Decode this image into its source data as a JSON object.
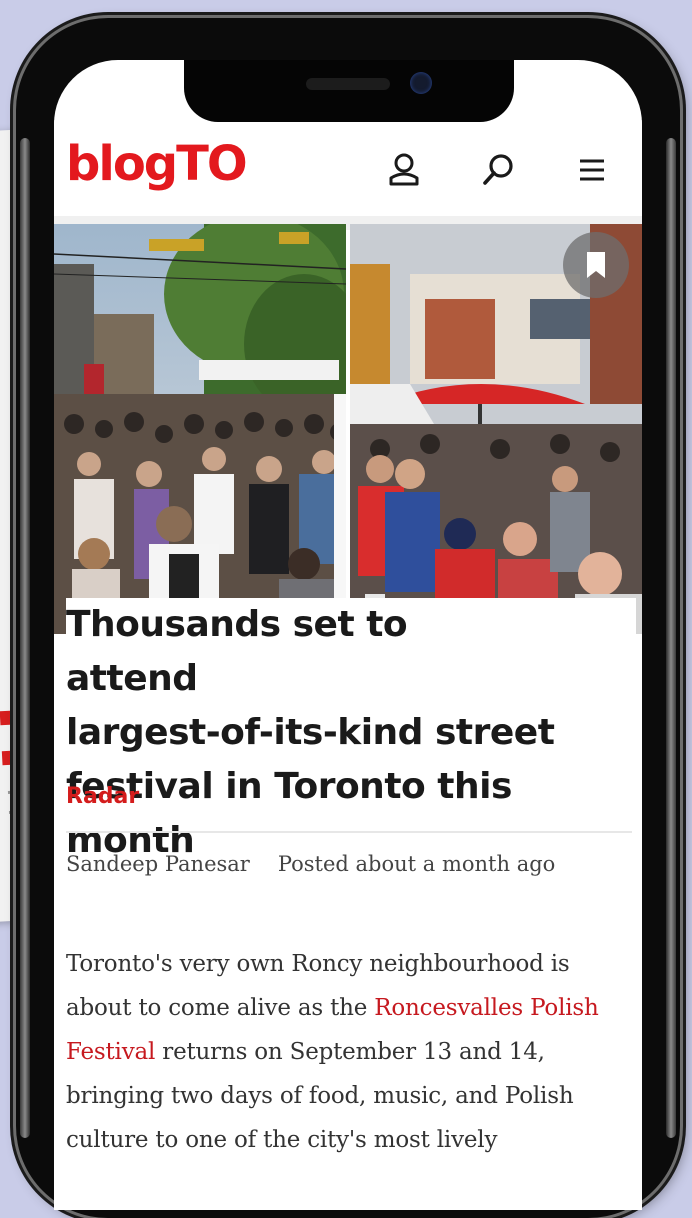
{
  "header": {
    "logo": "blogTO",
    "icons": [
      "user-icon",
      "search-icon",
      "menu-icon"
    ]
  },
  "hero": {
    "description_icons": [
      "bookmark-icon"
    ]
  },
  "article": {
    "headline": "Thousands set to attend largest-of-its-kind street festival in Toronto this month",
    "headline_lines": [
      "Thousands set to attend",
      "largest-of-its-kind street",
      "festival in Toronto this month"
    ],
    "category": "Radar",
    "author": "Sandeep Panesar",
    "posted": "Posted about a month ago",
    "body_start": "Toronto's very own Roncy neighbourhood is about to come alive as the ",
    "body_link": "Roncesvalles Polish Festival",
    "body_end": " returns on September 13 and 14, bringing two days of food, music, and Polish culture to one of the city's most lively"
  },
  "colors": {
    "brand_red": "#e3191e",
    "background": "#c9cce8"
  }
}
